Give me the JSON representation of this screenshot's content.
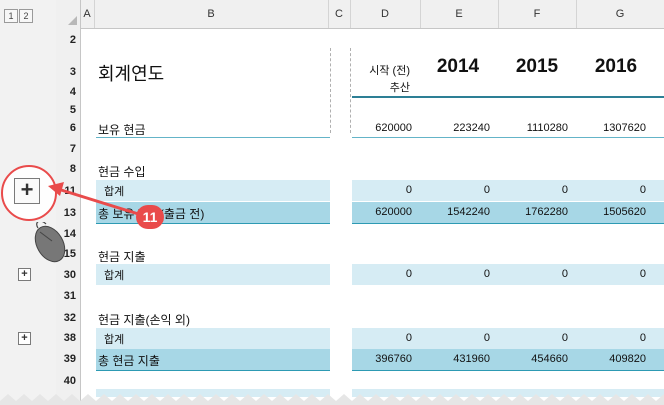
{
  "outline_levels": [
    "1",
    "2"
  ],
  "columns": [
    "A",
    "B",
    "C",
    "D",
    "E",
    "F",
    "G"
  ],
  "rows": [
    "2",
    "3",
    "4",
    "5",
    "6",
    "7",
    "8",
    "11",
    "13",
    "14",
    "15",
    "30",
    "31",
    "32",
    "38",
    "39",
    "40"
  ],
  "header": {
    "title": "회계연도",
    "start_label_line1": "시작 (전)",
    "start_label_line2": "추산",
    "years": [
      "2014",
      "2015",
      "2016"
    ]
  },
  "table": {
    "cash_on_hand": {
      "label": "보유 현금",
      "values": [
        "620000",
        "223240",
        "1110280",
        "1307620"
      ]
    },
    "income_title": "현금 수입",
    "income_total": {
      "label": "합계",
      "values": [
        "0",
        "0",
        "0",
        "0"
      ]
    },
    "total_available": {
      "label": "총 보유 현금(출금 전)",
      "values": [
        "620000",
        "1542240",
        "1762280",
        "1505620"
      ]
    },
    "expense_title": "현금 지출",
    "expense_total": {
      "label": "합계",
      "values": [
        "0",
        "0",
        "0",
        "0"
      ]
    },
    "nonop_title": "현금 지출(손익 외)",
    "nonop_total": {
      "label": "합계",
      "values": [
        "0",
        "0",
        "0",
        "0"
      ]
    },
    "total_expense": {
      "label": "총 현금 지출",
      "values": [
        "396760",
        "431960",
        "454660",
        "409820"
      ]
    }
  },
  "callout": {
    "badge": "11",
    "icon": "mouse-icon"
  },
  "colors": {
    "accent": "#e94b4b",
    "band_light": "#d6ecf4",
    "band_dark": "#a7d7e6",
    "teal": "#2d7f95"
  }
}
